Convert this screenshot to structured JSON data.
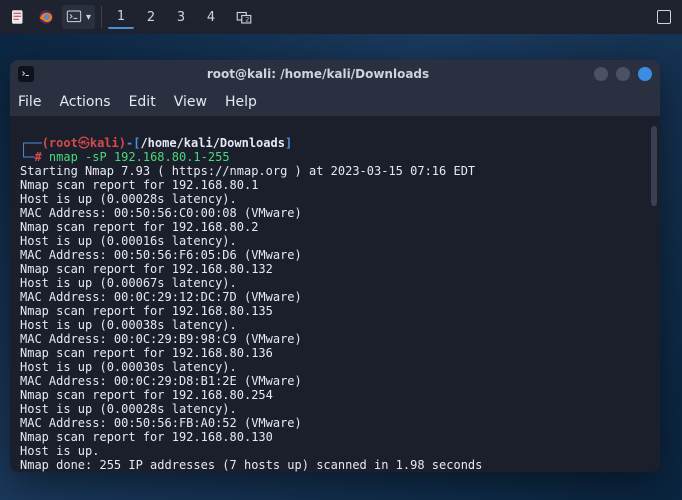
{
  "panel": {
    "workspaces": [
      "1",
      "2",
      "3",
      "4"
    ],
    "active_workspace": 0
  },
  "window": {
    "title": "root@kali: /home/kali/Downloads",
    "menus": {
      "file": "File",
      "actions": "Actions",
      "edit": "Edit",
      "view": "View",
      "help": "Help"
    }
  },
  "prompt": {
    "open_paren": "(",
    "user": "root",
    "at": "㉿",
    "host": "kali",
    "close_paren": ")",
    "dash": "-",
    "lbrack": "[",
    "cwd": "/home/kali/Downloads",
    "rbrack": "]",
    "hash": "#",
    "cmd": "nmap -sP 192.168.80.1-255"
  },
  "output": [
    "Starting Nmap 7.93 ( https://nmap.org ) at 2023-03-15 07:16 EDT",
    "Nmap scan report for 192.168.80.1",
    "Host is up (0.00028s latency).",
    "MAC Address: 00:50:56:C0:00:08 (VMware)",
    "Nmap scan report for 192.168.80.2",
    "Host is up (0.00016s latency).",
    "MAC Address: 00:50:56:F6:05:D6 (VMware)",
    "Nmap scan report for 192.168.80.132",
    "Host is up (0.00067s latency).",
    "MAC Address: 00:0C:29:12:DC:7D (VMware)",
    "Nmap scan report for 192.168.80.135",
    "Host is up (0.00038s latency).",
    "MAC Address: 00:0C:29:B9:98:C9 (VMware)",
    "Nmap scan report for 192.168.80.136",
    "Host is up (0.00030s latency).",
    "MAC Address: 00:0C:29:D8:B1:2E (VMware)",
    "Nmap scan report for 192.168.80.254",
    "Host is up (0.00028s latency).",
    "MAC Address: 00:50:56:FB:A0:52 (VMware)",
    "Nmap scan report for 192.168.80.130",
    "Host is up.",
    "Nmap done: 255 IP addresses (7 hosts up) scanned in 1.98 seconds"
  ]
}
